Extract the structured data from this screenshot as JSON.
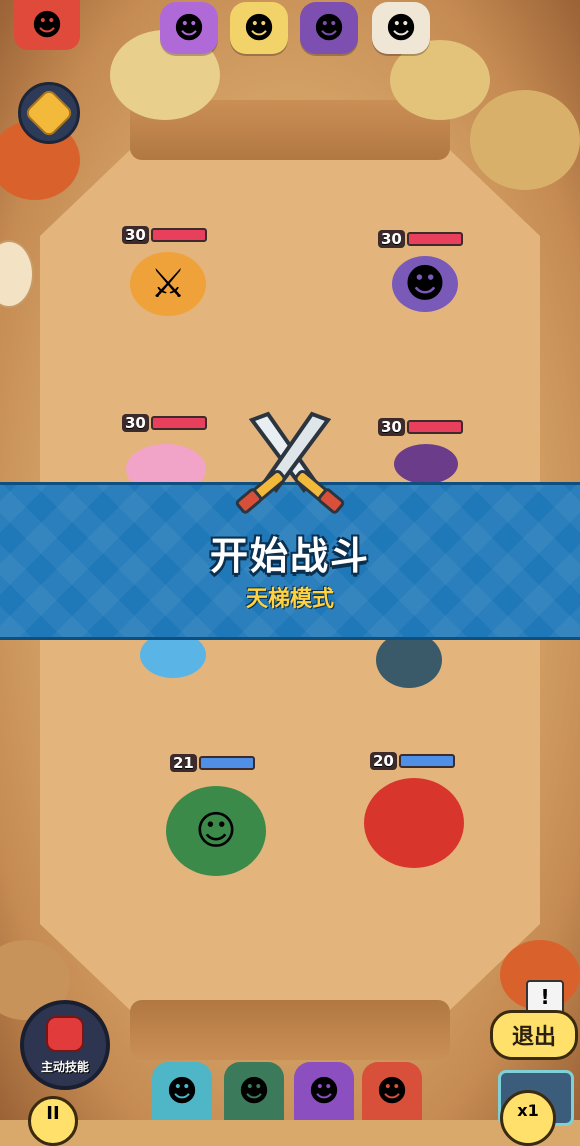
{
  "top_bar": {
    "player_portrait_icon": "masked-hero-icon",
    "enemy_portraits": [
      {
        "icon": "purple-cat-icon",
        "color": "#b06ad8"
      },
      {
        "icon": "white-cat-icon",
        "color": "#f2d36a"
      },
      {
        "icon": "jester-mask-icon",
        "color": "#7d4fb0"
      },
      {
        "icon": "lion-icon",
        "color": "#f0e6d6"
      }
    ]
  },
  "units": {
    "enemies": [
      {
        "level": "30",
        "name_icon": "tiger-dual-blade-icon",
        "color": "#f0a23a"
      },
      {
        "level": "30",
        "name_icon": "jester-axe-icon",
        "color": "#7a5ab8"
      },
      {
        "level": "30",
        "name_icon": "pink-dragon-icon",
        "color": "#f2a3c8"
      },
      {
        "level": "30",
        "name_icon": "witch-cat-icon",
        "color": "#6b3c8a"
      }
    ],
    "allies": [
      {
        "level": "21",
        "name_icon": "boxer-frog-icon",
        "color": "#3c8a4a"
      },
      {
        "level": "20",
        "name_icon": "red-flower-monster-icon",
        "color": "#d8362c"
      }
    ]
  },
  "banner": {
    "title": "开始战斗",
    "subtitle": "天梯模式"
  },
  "bottom": {
    "skill_label": "主动技能",
    "exit_label": "退出",
    "pause_label": "II",
    "speed_label": "x1",
    "warning_label": "!",
    "bench": [
      {
        "icon": "teal-spiky-hero-icon",
        "color": "#4fb6c8"
      },
      {
        "icon": "green-hood-hero-icon",
        "color": "#3b7a5a"
      },
      {
        "icon": "purple-fruit-hero-icon",
        "color": "#8b4fc0"
      },
      {
        "icon": "red-fox-hero-icon",
        "color": "#d8503a"
      }
    ]
  }
}
